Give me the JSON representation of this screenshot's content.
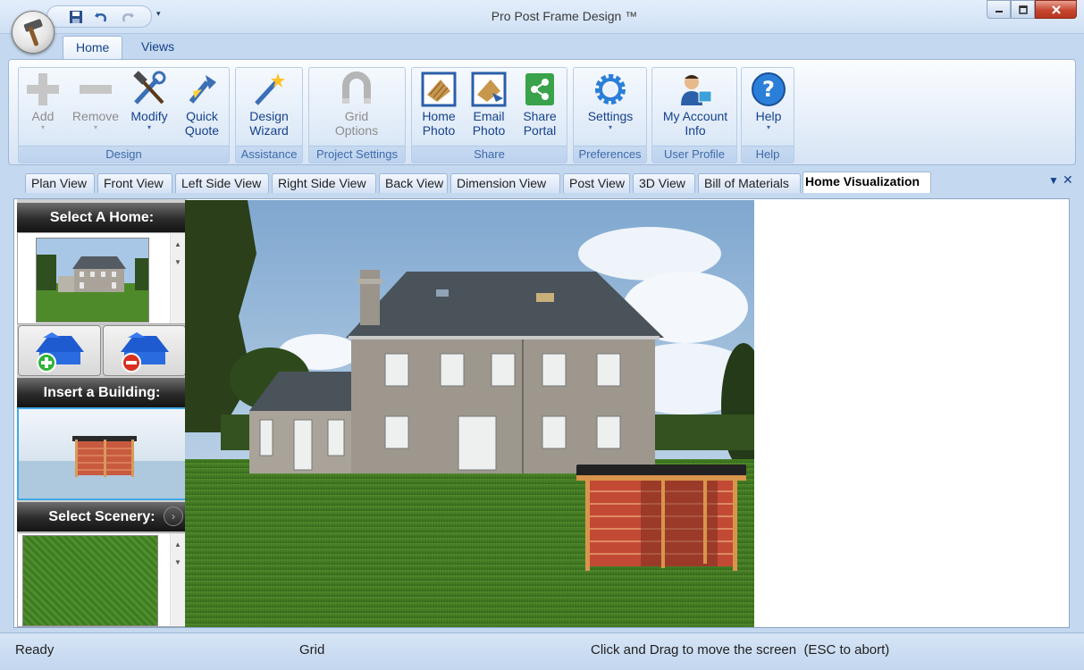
{
  "window": {
    "title": "Pro Post Frame Design ™"
  },
  "ribbon": {
    "tabs": [
      {
        "label": "Home"
      },
      {
        "label": "Views"
      }
    ],
    "groups": {
      "design": {
        "label": "Design",
        "add": "Add",
        "remove": "Remove",
        "modify": "Modify",
        "quick_quote": "Quick\nQuote"
      },
      "assistance": {
        "label": "Assistance",
        "design_wizard": "Design\nWizard"
      },
      "project_settings": {
        "label": "Project Settings",
        "grid_options": "Grid\nOptions"
      },
      "share": {
        "label": "Share",
        "home_photo": "Home\nPhoto",
        "email_photo": "Email\nPhoto",
        "share_portal": "Share\nPortal"
      },
      "preferences": {
        "label": "Preferences",
        "settings": "Settings"
      },
      "user_profile": {
        "label": "User Profile",
        "my_account": "My Account\nInfo"
      },
      "help": {
        "label": "Help",
        "help": "Help"
      }
    }
  },
  "doc_tabs": [
    {
      "label": "Plan View"
    },
    {
      "label": "Front View"
    },
    {
      "label": "Left Side View"
    },
    {
      "label": "Right Side View"
    },
    {
      "label": "Back View"
    },
    {
      "label": "Dimension View"
    },
    {
      "label": "Post View"
    },
    {
      "label": "3D View"
    },
    {
      "label": "Bill of Materials"
    },
    {
      "label": "Home Visualization"
    }
  ],
  "left_panel": {
    "select_home": "Select A Home:",
    "insert_building": "Insert a Building:",
    "select_scenery": "Select Scenery:"
  },
  "status": {
    "ready": "Ready",
    "grid": "Grid",
    "hint": "Click and Drag to move the screen  (ESC to abort)"
  },
  "colors": {
    "ribbon_text": "#15428b",
    "group_label": "#3e6aaa",
    "close_button": "#c64630",
    "panel_header": "#2b2b2b"
  }
}
